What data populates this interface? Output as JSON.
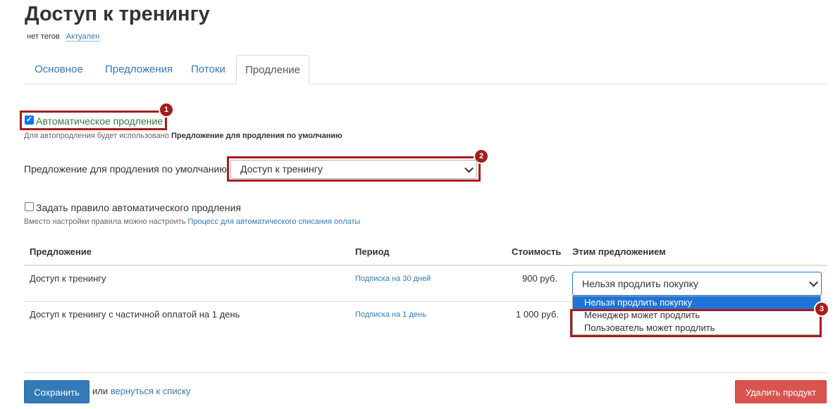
{
  "header": {
    "title": "Доступ к тренингу",
    "tags_label": "нет тегов",
    "status": "Актуален"
  },
  "tabs": [
    {
      "label": "Основное"
    },
    {
      "label": "Предложения"
    },
    {
      "label": "Потоки"
    },
    {
      "label": "Продление"
    }
  ],
  "auto_renewal": {
    "checked": true,
    "label": "Автоматическое продление",
    "help_prefix": "Для автопродления будет использовано",
    "help_bold": "Предложение для продления по умолчанию"
  },
  "default_offer": {
    "label": "Предложение для продления по умолчанию:",
    "value": "Доступ к тренингу"
  },
  "rule": {
    "checked": false,
    "label": "Задать правило автоматического продления",
    "help_prefix": "Вместо настройки правила можно настроить",
    "help_link": "Процесс для автоматического списания оплаты"
  },
  "table": {
    "headers": [
      "Предложение",
      "Период",
      "Стоимость",
      "Этим предложением"
    ],
    "rows": [
      {
        "offer": "Доступ к тренингу",
        "period": "Подписка на 30 дней",
        "price": "900 руб.",
        "select": "Нельзя продлить покупку"
      },
      {
        "offer": "Доступ к тренингу с частичной оплатой на 1 день",
        "period": "Подписка на 1 день",
        "price": "1 000 руб."
      }
    ],
    "dropdown_options": [
      "Нельзя продлить покупку",
      "Менеджер может продлить",
      "Пользователь может продлить"
    ]
  },
  "annotations": [
    "1",
    "2",
    "3"
  ],
  "footer": {
    "save": "Сохранить",
    "or": "или",
    "back": "вернуться к списку",
    "delete": "Удалить продукт"
  },
  "colors": {
    "link": "#337ab7",
    "save": "#337ab7",
    "delete": "#d9534f",
    "highlight": "#a71c1c",
    "selected_option": "#1e74d8"
  }
}
